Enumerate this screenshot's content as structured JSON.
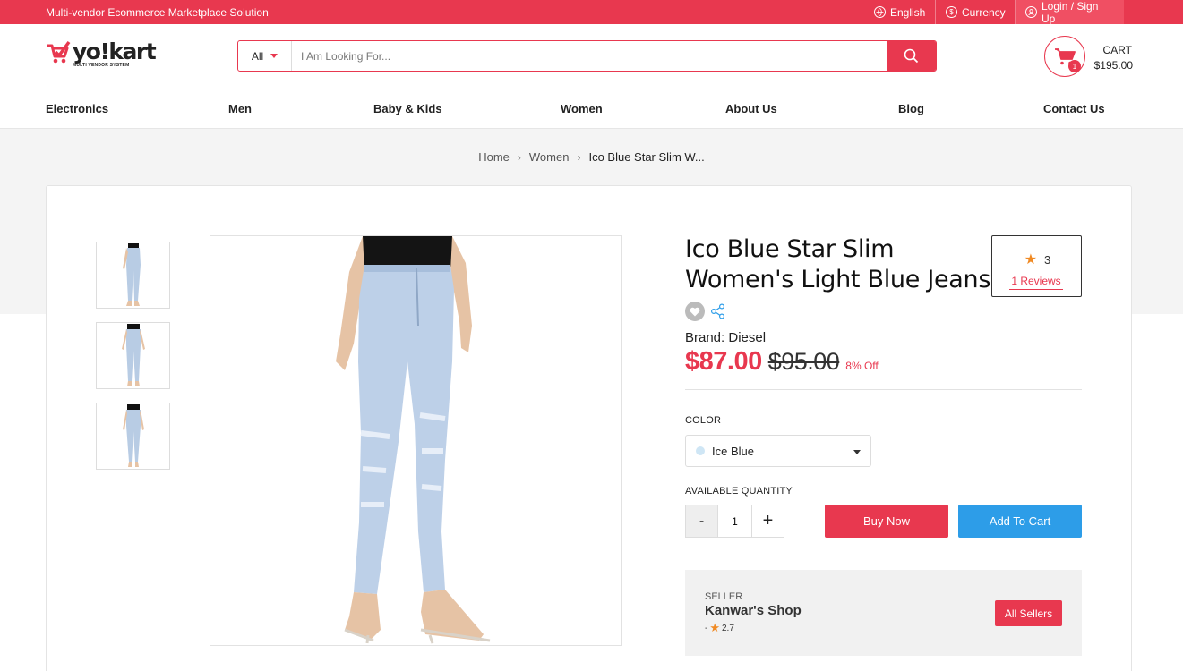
{
  "topbar": {
    "tagline": "Multi-vendor Ecommerce Marketplace Solution",
    "language": "English",
    "currency": "Currency",
    "login": "Login / Sign Up"
  },
  "header": {
    "logo_text": "yo!kart",
    "logo_sub": "MULTI VENDOR SYSTEM",
    "search_category": "All",
    "search_placeholder": "I Am Looking For...",
    "cart_label": "CART",
    "cart_amount": "$195.00",
    "cart_count": "1"
  },
  "nav": [
    "Electronics",
    "Men",
    "Baby & Kids",
    "Women",
    "About Us",
    "Blog",
    "Contact Us"
  ],
  "breadcrumb": {
    "home": "Home",
    "category": "Women",
    "current": "Ico Blue Star Slim W..."
  },
  "product": {
    "title": "Ico Blue Star Slim Women's Light Blue Jeans",
    "rating": "3",
    "reviews": "1 Reviews",
    "brand": "Brand: Diesel",
    "price": "$87.00",
    "old_price": "$95.00",
    "discount": "8% Off",
    "color_label": "COLOR",
    "color_value": "Ice Blue",
    "color_swatch": "#cfe6f5",
    "qty_label": "AVAILABLE QUANTITY",
    "qty_minus": "-",
    "qty_value": "1",
    "qty_plus": "+",
    "buy_now": "Buy Now",
    "add_to_cart": "Add To Cart"
  },
  "seller": {
    "label": "SELLER",
    "name": "Kanwar's Shop",
    "rating_prefix": "-",
    "rating": "2.7",
    "all_sellers": "All Sellers"
  },
  "colors": {
    "accent": "#e8384f",
    "blue": "#2d9de8",
    "star": "#f08a24"
  }
}
